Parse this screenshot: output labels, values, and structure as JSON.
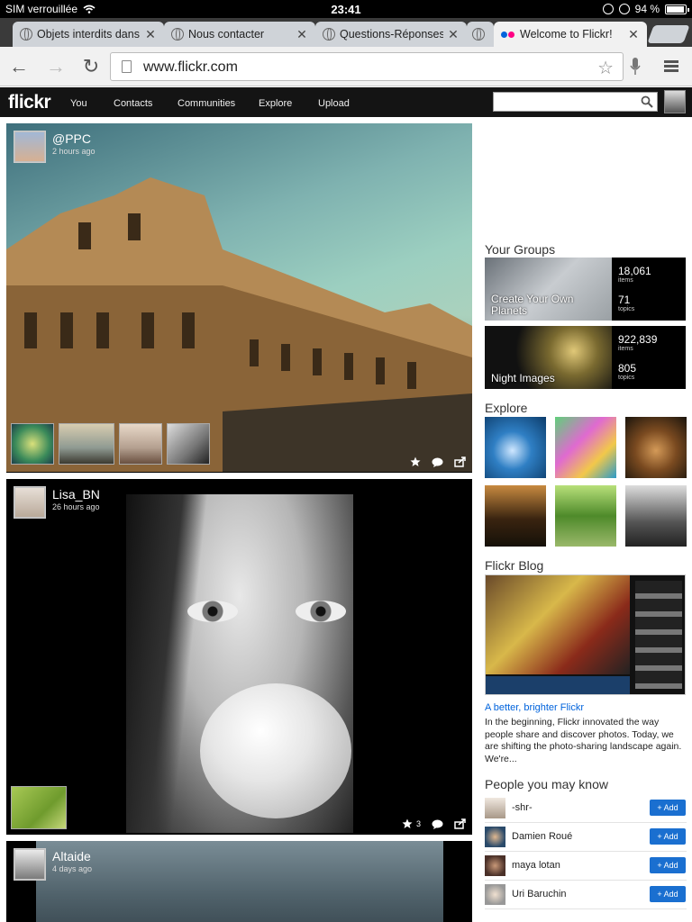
{
  "status_bar": {
    "carrier": "SIM verrouillée",
    "time": "23:41",
    "battery": "94 %",
    "battery_level": 0.94
  },
  "browser": {
    "tabs": [
      {
        "title": "Objets interdits dans",
        "active": false
      },
      {
        "title": "Nous contacter",
        "active": false
      },
      {
        "title": "Questions-Réponses",
        "active": false
      },
      {
        "title": "",
        "active": false
      },
      {
        "title": "Welcome to Flickr!",
        "active": true
      }
    ],
    "url": "www.flickr.com"
  },
  "flickr_nav": {
    "logo": "flickr",
    "links": [
      "You",
      "Contacts",
      "Communities",
      "Explore",
      "Upload"
    ],
    "search_placeholder": ""
  },
  "feed": [
    {
      "user": "@PPC",
      "time": "2 hours ago",
      "thumb_count": 4,
      "actions": {
        "favorites": ""
      }
    },
    {
      "user": "Lisa_BN",
      "time": "26 hours ago",
      "thumb_count": 1,
      "actions": {
        "favorites": "3"
      }
    },
    {
      "user": "Altaide",
      "time": "4 days ago"
    }
  ],
  "sidebar": {
    "groups_title": "Your Groups",
    "groups": [
      {
        "name": "Create Your Own Planets",
        "items": "18,061",
        "items_label": "items",
        "topics": "71",
        "topics_label": "topics"
      },
      {
        "name": "Night Images",
        "items": "922,839",
        "items_label": "items",
        "topics": "805",
        "topics_label": "topics"
      }
    ],
    "explore_title": "Explore",
    "blog_title": "Flickr Blog",
    "blog_post_title": "A better, brighter Flickr",
    "blog_post_excerpt": "In the beginning, Flickr innovated the way people share and discover photos. Today, we are shifting the photo-sharing landscape again. We're...",
    "people_title": "People you may know",
    "add_label": "+ Add",
    "people": [
      "-shr-",
      "Damien Roué",
      "maya lotan",
      "Uri Baruchin"
    ]
  },
  "colors": {
    "flickr_blue": "#0063dc",
    "flickr_pink": "#ff0084",
    "add_button": "#1a6fd0",
    "nav_bg": "#141414"
  }
}
